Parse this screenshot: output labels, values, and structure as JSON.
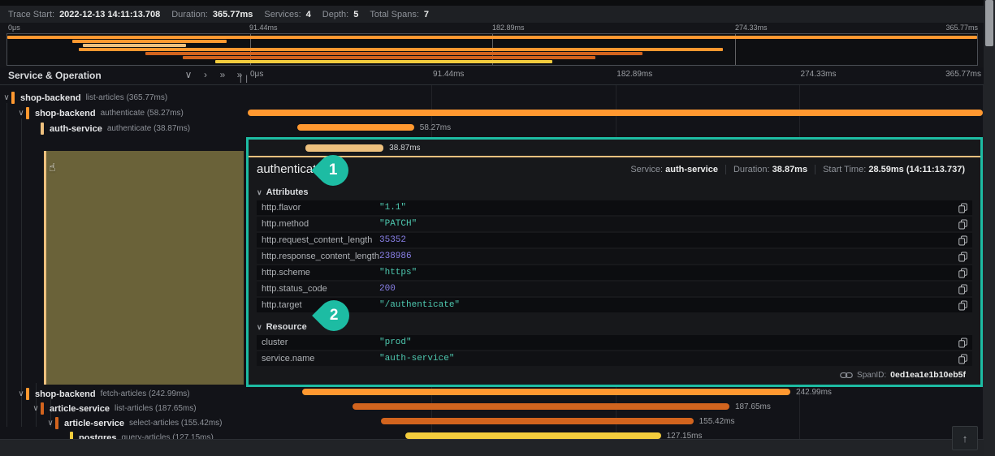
{
  "header": {
    "trace_start_label": "Trace Start:",
    "trace_start": "2022-12-13 14:11:13.708",
    "duration_label": "Duration:",
    "duration": "365.77ms",
    "services_label": "Services:",
    "services": "4",
    "depth_label": "Depth:",
    "depth": "5",
    "total_spans_label": "Total Spans:",
    "total_spans": "7"
  },
  "timeline": {
    "total_ms": 365.77,
    "ticks": [
      "0μs",
      "91.44ms",
      "182.89ms",
      "274.33ms",
      "365.77ms"
    ]
  },
  "left_panel": {
    "title": "Service & Operation"
  },
  "icons": {
    "collapse_one": "∨",
    "expand_one": "›",
    "collapse_all": "»",
    "expand_all": "»",
    "resizer": "| |",
    "tree_chevron": "∨",
    "section_chevron": "∨",
    "scroll_top": "↑",
    "cursor": "☝"
  },
  "tree": [
    {
      "service": "shop-backend",
      "operation": "list-articles (365.77ms)",
      "depth": 0,
      "expanded": true,
      "color": "shop_backend"
    },
    {
      "service": "shop-backend",
      "operation": "authenticate (58.27ms)",
      "depth": 1,
      "expanded": true,
      "color": "shop_backend"
    },
    {
      "service": "auth-service",
      "operation": "authenticate (38.87ms)",
      "depth": 2,
      "expanded": false,
      "color": "auth_service",
      "selected": true
    },
    {
      "service": "shop-backend",
      "operation": "fetch-articles (242.99ms)",
      "depth": 1,
      "expanded": true,
      "color": "shop_backend"
    },
    {
      "service": "article-service",
      "operation": "list-articles (187.65ms)",
      "depth": 2,
      "expanded": true,
      "color": "article_service"
    },
    {
      "service": "article-service",
      "operation": "select-articles (155.42ms)",
      "depth": 3,
      "expanded": true,
      "color": "article_service"
    },
    {
      "service": "postgres",
      "operation": "query-articles (127.15ms)",
      "depth": 4,
      "expanded": false,
      "color": "postgres"
    }
  ],
  "spans": [
    {
      "name": "list-articles",
      "start_ms": 0,
      "duration_ms": 365.77,
      "label": "",
      "color": "shop_backend"
    },
    {
      "name": "authenticate",
      "start_ms": 24.5,
      "duration_ms": 58.27,
      "label": "58.27ms",
      "color": "shop_backend"
    },
    {
      "name": "authenticate",
      "start_ms": 28.59,
      "duration_ms": 38.87,
      "label": "38.87ms",
      "color": "auth_service"
    },
    {
      "name": "fetch-articles",
      "start_ms": 27.0,
      "duration_ms": 242.99,
      "label": "242.99ms",
      "color": "shop_backend"
    },
    {
      "name": "list-articles",
      "start_ms": 52.0,
      "duration_ms": 187.65,
      "label": "187.65ms",
      "color": "article_service"
    },
    {
      "name": "select-articles",
      "start_ms": 66.3,
      "duration_ms": 155.42,
      "label": "155.42ms",
      "color": "article_service"
    },
    {
      "name": "query-articles",
      "start_ms": 78.4,
      "duration_ms": 127.15,
      "label": "127.15ms",
      "color": "postgres"
    }
  ],
  "detail": {
    "title": "authenticate",
    "service_label": "Service:",
    "service": "auth-service",
    "duration_label": "Duration:",
    "duration": "38.87ms",
    "start_label": "Start Time:",
    "start": "28.59ms (14:11:13.737)",
    "attributes_title": "Attributes",
    "attributes": [
      {
        "key": "http.flavor",
        "value": "\"1.1\"",
        "kind": "string"
      },
      {
        "key": "http.method",
        "value": "\"PATCH\"",
        "kind": "string"
      },
      {
        "key": "http.request_content_length",
        "value": "35352",
        "kind": "number"
      },
      {
        "key": "http.response_content_length",
        "value": "238986",
        "kind": "number"
      },
      {
        "key": "http.scheme",
        "value": "\"https\"",
        "kind": "string"
      },
      {
        "key": "http.status_code",
        "value": "200",
        "kind": "number"
      },
      {
        "key": "http.target",
        "value": "\"/authenticate\"",
        "kind": "string"
      }
    ],
    "resource_title": "Resource",
    "resource": [
      {
        "key": "cluster",
        "value": "\"prod\"",
        "kind": "string"
      },
      {
        "key": "service.name",
        "value": "\"auth-service\"",
        "kind": "string"
      }
    ],
    "span_id_label": "SpanID:",
    "span_id": "0ed1ea1e1b10eb5f"
  },
  "annotations": {
    "callout1": "1",
    "callout2": "2"
  },
  "colors": {
    "shop_backend": "#FF9830",
    "auth_service": "#EDC07E",
    "article_service": "#D2641E",
    "postgres": "#F2CC3D",
    "annotation": "#1DBCA3",
    "string_value": "#4EC9B0",
    "number_value": "#8980E8"
  }
}
